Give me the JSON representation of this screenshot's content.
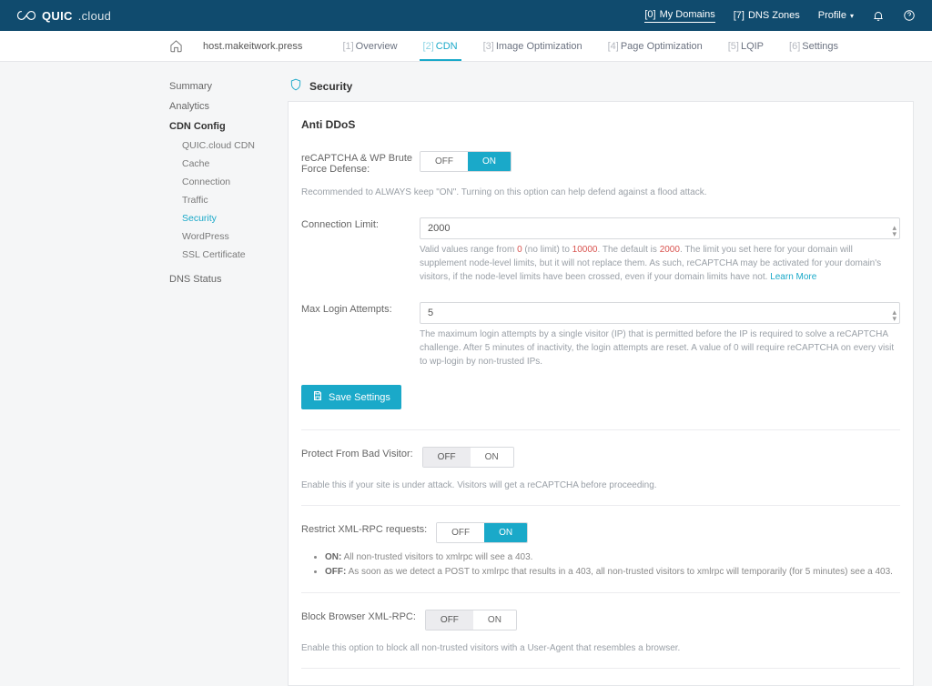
{
  "brand": {
    "main": "QUIC",
    "sub": ".cloud"
  },
  "topnav": {
    "domains_prefix": "[0]",
    "domains": "My Domains",
    "dns_prefix": "[7]",
    "dns": "DNS Zones",
    "profile": "Profile"
  },
  "subbar": {
    "host": "host.makeitwork.press"
  },
  "tabs": {
    "overview_num": "[1]",
    "overview": "Overview",
    "cdn_num": "[2]",
    "cdn": "CDN",
    "img_num": "[3]",
    "img": "Image Optimization",
    "page_num": "[4]",
    "page": "Page Optimization",
    "lqip_num": "[5]",
    "lqip": "LQIP",
    "settings_num": "[6]",
    "settings": "Settings"
  },
  "sidebar": {
    "summary": "Summary",
    "analytics": "Analytics",
    "cdnconfig": "CDN Config",
    "sub": {
      "quiccdn": "QUIC.cloud CDN",
      "cache": "Cache",
      "connection": "Connection",
      "traffic": "Traffic",
      "security": "Security",
      "wordpress": "WordPress",
      "ssl": "SSL Certificate"
    },
    "dnsstatus": "DNS Status"
  },
  "panel": {
    "title": "Security"
  },
  "section": {
    "antiddos": "Anti DDoS",
    "recaptcha": {
      "label": "reCAPTCHA & WP Brute Force Defense:",
      "off": "OFF",
      "on": "ON",
      "desc": "Recommended to ALWAYS keep \"ON\". Turning on this option can help defend against a flood attack."
    },
    "connlimit": {
      "label": "Connection Limit:",
      "value": "2000",
      "desc_pre": "Valid values range from ",
      "desc_zero": "0",
      "desc_mid1": " (no limit) to ",
      "desc_max": "10000",
      "desc_mid2": ". The default is ",
      "desc_default": "2000",
      "desc_after": ". The limit you set here for your domain will supplement node-level limits, but it will not replace them. As such, reCAPTCHA may be activated for your domain's visitors, if the node-level limits have been crossed, even if your domain limits have not. ",
      "learn": "Learn More"
    },
    "maxlogin": {
      "label": "Max Login Attempts:",
      "value": "5",
      "desc": "The maximum login attempts by a single visitor (IP) that is permitted before the IP is required to solve a reCAPTCHA challenge. After 5 minutes of inactivity, the login attempts are reset. A value of 0 will require reCAPTCHA on every visit to wp-login by non-trusted IPs."
    },
    "save": "Save Settings",
    "badvisitor": {
      "label": "Protect From Bad Visitor:",
      "off": "OFF",
      "on": "ON",
      "desc": "Enable this if your site is under attack. Visitors will get a reCAPTCHA before proceeding."
    },
    "xmlrpc": {
      "label": "Restrict XML-RPC requests:",
      "off": "OFF",
      "on": "ON",
      "bullet_on_label": "ON:",
      "bullet_on": "All non-trusted visitors to xmlrpc will see a 403.",
      "bullet_off_label": "OFF:",
      "bullet_off": "As soon as we detect a POST to xmlrpc that results in a 403, all non-trusted visitors to xmlrpc will temporarily (for 5 minutes) see a 403."
    },
    "blockbrowser": {
      "label": "Block Browser XML-RPC:",
      "off": "OFF",
      "on": "ON",
      "desc": "Enable this option to block all non-trusted visitors with a User-Agent that resembles a browser."
    }
  }
}
